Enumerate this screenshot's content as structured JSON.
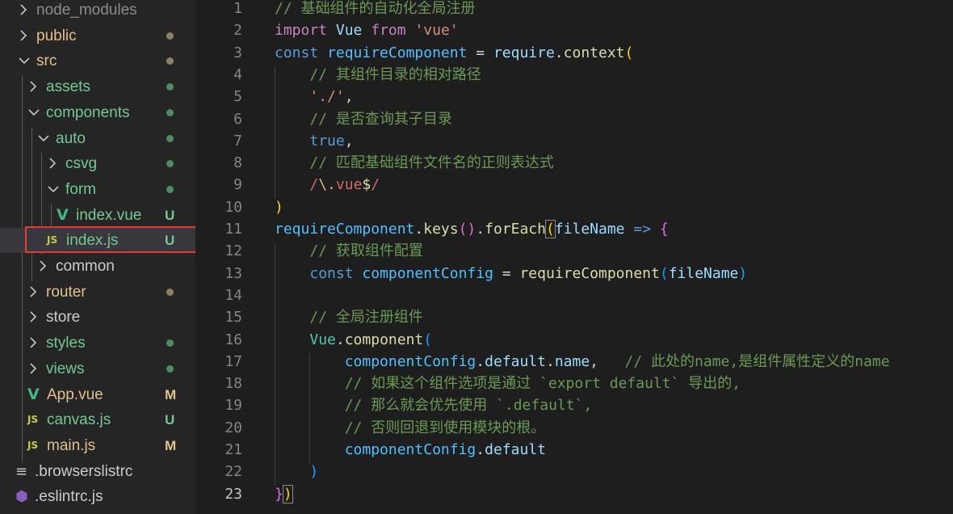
{
  "colors": {
    "sidebar_bg": "#252526",
    "editor_bg": "#1e1e1e",
    "untracked": "#73c991",
    "modified": "#e2c08d",
    "ignored": "#8c8c8c",
    "highlight_border": "#e53935"
  },
  "explorer": {
    "items": [
      {
        "label": "node_modules",
        "chevron": "right",
        "icon": "",
        "decoration": "",
        "color": "#8c8c8c"
      },
      {
        "label": "public",
        "chevron": "right",
        "icon": "",
        "decoration": "dot",
        "color": "#e2c08d"
      },
      {
        "label": "src",
        "chevron": "down",
        "icon": "",
        "decoration": "dot",
        "color": "#e2c08d"
      },
      {
        "label": "assets",
        "chevron": "right",
        "icon": "",
        "decoration": "dot",
        "color": "#73c991"
      },
      {
        "label": "components",
        "chevron": "down",
        "icon": "",
        "decoration": "dot",
        "color": "#73c991"
      },
      {
        "label": "auto",
        "chevron": "down",
        "icon": "",
        "decoration": "dot",
        "color": "#73c991"
      },
      {
        "label": "csvg",
        "chevron": "right",
        "icon": "",
        "decoration": "dot",
        "color": "#73c991"
      },
      {
        "label": "form",
        "chevron": "down",
        "icon": "",
        "decoration": "dot",
        "color": "#73c991"
      },
      {
        "label": "index.vue",
        "chevron": "",
        "icon": "vue",
        "icon_glyph": "V",
        "decoration": "U",
        "color": "#73c991"
      },
      {
        "label": "index.js",
        "chevron": "",
        "icon": "js",
        "icon_glyph": "JS",
        "decoration": "U",
        "color": "#73c991",
        "selected": true
      },
      {
        "label": "common",
        "chevron": "right",
        "icon": "",
        "decoration": "",
        "color": "#cccccc"
      },
      {
        "label": "router",
        "chevron": "right",
        "icon": "",
        "decoration": "dot",
        "color": "#e2c08d"
      },
      {
        "label": "store",
        "chevron": "right",
        "icon": "",
        "decoration": "",
        "color": "#cccccc"
      },
      {
        "label": "styles",
        "chevron": "right",
        "icon": "",
        "decoration": "dot",
        "color": "#73c991"
      },
      {
        "label": "views",
        "chevron": "right",
        "icon": "",
        "decoration": "dot",
        "color": "#73c991"
      },
      {
        "label": "App.vue",
        "chevron": "",
        "icon": "vue",
        "icon_glyph": "V",
        "decoration": "M",
        "color": "#e2c08d"
      },
      {
        "label": "canvas.js",
        "chevron": "",
        "icon": "js",
        "icon_glyph": "JS",
        "decoration": "U",
        "color": "#73c991"
      },
      {
        "label": "main.js",
        "chevron": "",
        "icon": "js",
        "icon_glyph": "JS",
        "decoration": "M",
        "color": "#e2c08d"
      },
      {
        "label": ".browserslistrc",
        "chevron": "",
        "icon": "rc",
        "icon_glyph": "≡",
        "decoration": "",
        "color": "#cccccc"
      },
      {
        "label": ".eslintrc.js",
        "chevron": "",
        "icon": "eslint",
        "icon_glyph": "⬢",
        "decoration": "",
        "color": "#cccccc"
      }
    ]
  },
  "editor": {
    "active_line": 23,
    "lines": [
      [
        [
          "// 基础组件的自动化全局注册",
          "#6a9955"
        ]
      ],
      [
        [
          "import",
          "#c586c0"
        ],
        [
          " ",
          "#d4d4d4"
        ],
        [
          "Vue",
          "#9cdcfe"
        ],
        [
          " ",
          "#d4d4d4"
        ],
        [
          "from",
          "#c586c0"
        ],
        [
          " ",
          "#d4d4d4"
        ],
        [
          "'vue'",
          "#ce9178"
        ]
      ],
      [
        [
          "const",
          "#569cd6"
        ],
        [
          " ",
          "#d4d4d4"
        ],
        [
          "requireComponent",
          "#4fc1ff"
        ],
        [
          " = ",
          "#d4d4d4"
        ],
        [
          "require",
          "#9cdcfe"
        ],
        [
          ".",
          "#d4d4d4"
        ],
        [
          "context",
          "#dcdcaa"
        ],
        [
          "(",
          "#ffd700"
        ]
      ],
      [
        [
          "    ",
          "#d4d4d4"
        ],
        [
          "// 其组件目录的相对路径",
          "#6a9955"
        ]
      ],
      [
        [
          "    ",
          "#d4d4d4"
        ],
        [
          "'./'",
          "#ce9178"
        ],
        [
          ",",
          "#d4d4d4"
        ]
      ],
      [
        [
          "    ",
          "#d4d4d4"
        ],
        [
          "// 是否查询其子目录",
          "#6a9955"
        ]
      ],
      [
        [
          "    ",
          "#d4d4d4"
        ],
        [
          "true",
          "#569cd6"
        ],
        [
          ",",
          "#d4d4d4"
        ]
      ],
      [
        [
          "    ",
          "#d4d4d4"
        ],
        [
          "// 匹配基础组件文件名的正则表达式",
          "#6a9955"
        ]
      ],
      [
        [
          "    ",
          "#d4d4d4"
        ],
        [
          "/",
          "#d16969"
        ],
        [
          "\\.",
          "#d7ba7d"
        ],
        [
          "vue",
          "#d16969"
        ],
        [
          "$",
          "#dcdcaa"
        ],
        [
          "/",
          "#d16969"
        ]
      ],
      [
        [
          ")",
          "#ffd700"
        ]
      ],
      [
        [
          "requireComponent",
          "#4fc1ff"
        ],
        [
          ".",
          "#d4d4d4"
        ],
        [
          "keys",
          "#dcdcaa"
        ],
        [
          "()",
          "#da70d6"
        ],
        [
          ".",
          "#d4d4d4"
        ],
        [
          "forEach",
          "#dcdcaa"
        ],
        [
          "(",
          "#ffd700"
        ],
        [
          "fileName",
          "#9cdcfe"
        ],
        [
          " ",
          "#d4d4d4"
        ],
        [
          "=>",
          "#569cd6"
        ],
        [
          " ",
          "#d4d4d4"
        ],
        [
          "{",
          "#da70d6"
        ]
      ],
      [
        [
          "    ",
          "#d4d4d4"
        ],
        [
          "// 获取组件配置",
          "#6a9955"
        ]
      ],
      [
        [
          "    ",
          "#d4d4d4"
        ],
        [
          "const",
          "#569cd6"
        ],
        [
          " ",
          "#d4d4d4"
        ],
        [
          "componentConfig",
          "#4fc1ff"
        ],
        [
          " = ",
          "#d4d4d4"
        ],
        [
          "requireComponent",
          "#dcdcaa"
        ],
        [
          "(",
          "#179fff"
        ],
        [
          "fileName",
          "#9cdcfe"
        ],
        [
          ")",
          "#179fff"
        ]
      ],
      [
        [
          "",
          "#d4d4d4"
        ]
      ],
      [
        [
          "    ",
          "#d4d4d4"
        ],
        [
          "// 全局注册组件",
          "#6a9955"
        ]
      ],
      [
        [
          "    ",
          "#d4d4d4"
        ],
        [
          "Vue",
          "#4ec9b0"
        ],
        [
          ".",
          "#d4d4d4"
        ],
        [
          "component",
          "#dcdcaa"
        ],
        [
          "(",
          "#179fff"
        ]
      ],
      [
        [
          "        ",
          "#d4d4d4"
        ],
        [
          "componentConfig",
          "#4fc1ff"
        ],
        [
          ".",
          "#d4d4d4"
        ],
        [
          "default",
          "#9cdcfe"
        ],
        [
          ".",
          "#d4d4d4"
        ],
        [
          "name",
          "#9cdcfe"
        ],
        [
          ",   ",
          "#d4d4d4"
        ],
        [
          "// 此处的name,是组件属性定义的name",
          "#6a9955"
        ]
      ],
      [
        [
          "        ",
          "#d4d4d4"
        ],
        [
          "// 如果这个组件选项是通过 `export default` 导出的,",
          "#6a9955"
        ]
      ],
      [
        [
          "        ",
          "#d4d4d4"
        ],
        [
          "// 那么就会优先使用 `.default`,",
          "#6a9955"
        ]
      ],
      [
        [
          "        ",
          "#d4d4d4"
        ],
        [
          "// 否则回退到使用模块的根。",
          "#6a9955"
        ]
      ],
      [
        [
          "        ",
          "#d4d4d4"
        ],
        [
          "componentConfig",
          "#4fc1ff"
        ],
        [
          ".",
          "#d4d4d4"
        ],
        [
          "default",
          "#9cdcfe"
        ]
      ],
      [
        [
          "    ",
          "#d4d4d4"
        ],
        [
          ")",
          "#179fff"
        ]
      ],
      [
        [
          "}",
          "#da70d6"
        ],
        [
          ")",
          "#ffd700"
        ]
      ]
    ]
  }
}
